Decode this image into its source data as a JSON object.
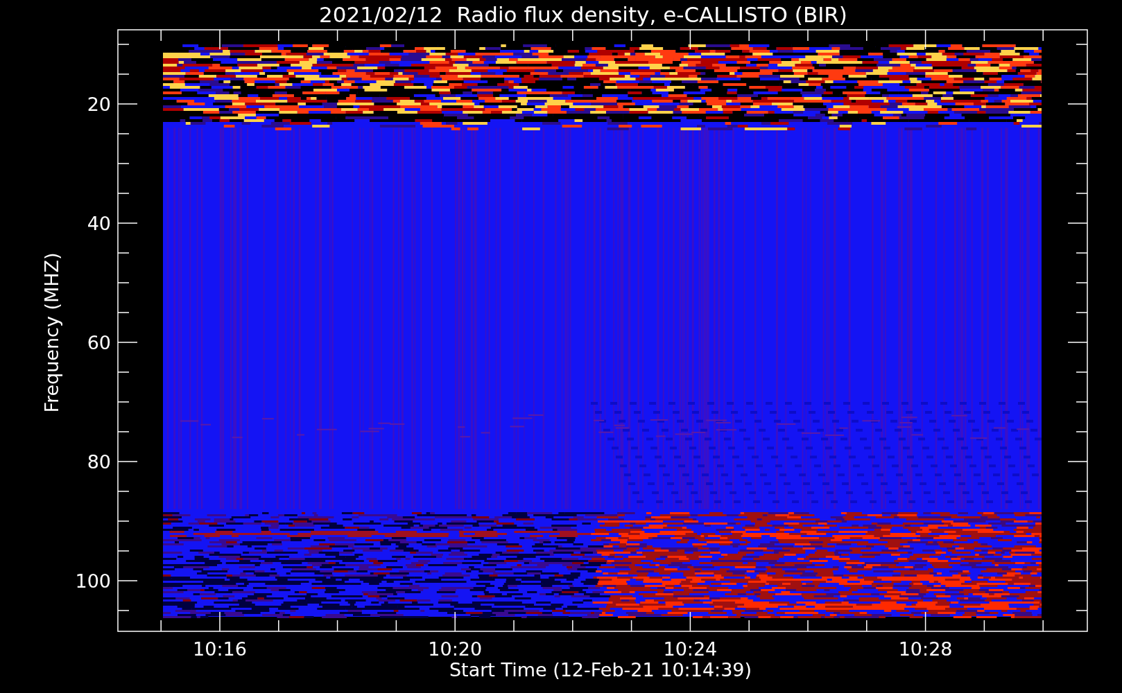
{
  "title": "2021/02/12  Radio flux density, e-CALLISTO (BIR)",
  "y_axis": {
    "label": "Frequency (MHZ)",
    "ticks": [
      "20",
      "40",
      "60",
      "80",
      "100"
    ]
  },
  "x_axis": {
    "label": "Start Time (12-Feb-21 10:14:39)",
    "ticks": [
      "10:16",
      "10:20",
      "10:24",
      "10:28"
    ]
  }
}
